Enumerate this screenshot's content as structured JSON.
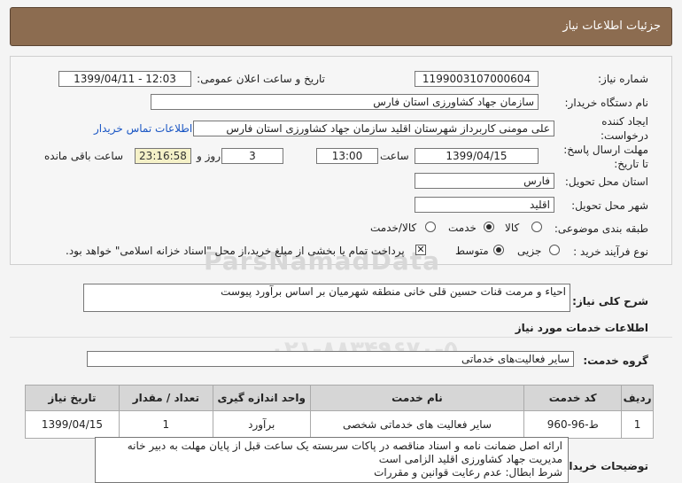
{
  "header": {
    "title": "جزئیات اطلاعات نیاز"
  },
  "fields": {
    "need_number_label": "شماره نیاز:",
    "need_number": "1199003107000604",
    "announce_label": "تاریخ و ساعت اعلان عمومی:",
    "announce_value": "1399/04/11 - 12:03",
    "buyer_label": "نام دستگاه خریدار:",
    "buyer_value": "سازمان جهاد کشاورزی استان فارس",
    "creator_label_1": "ایجاد کننده",
    "creator_label_2": "درخواست:",
    "creator_value": "علی  مومنی  کاربرداز شهرستان اقلید  سازمان جهاد کشاورزی استان فارس",
    "contact_link": "اطلاعات تماس خریدار",
    "deadline_label_1": "مهلت ارسال پاسخ:",
    "deadline_label_2": "تا تاریخ:",
    "deadline_date": "1399/04/15",
    "time_label": "ساعت",
    "deadline_time": "13:00",
    "days_value": "3",
    "days_label": "روز و",
    "remaining_time": "23:16:58",
    "remaining_label": "ساعت باقی مانده",
    "province_label": "استان محل تحویل:",
    "province_value": "فارس",
    "city_label": "شهر محل تحویل:",
    "city_value": "اقلید",
    "category_label": "طبقه بندی موضوعی:",
    "category_options": [
      "کالا",
      "خدمت",
      "کالا/خدمت"
    ],
    "category_selected": "خدمت",
    "process_label": "نوع فرآیند خرید :",
    "process_options": [
      "جزیی",
      "متوسط"
    ],
    "process_selected": "متوسط",
    "payment_note": "پرداخت تمام یا بخشی از مبلغ خرید،از محل \"اسناد خزانه اسلامی\" خواهد بود."
  },
  "summary": {
    "label": "شرح کلی نیاز:",
    "value": "احیاء و مرمت قنات حسین قلی خانی منطقه شهرمیان بر اساس برآورد پیوست"
  },
  "services_section": {
    "title": "اطلاعات خدمات مورد نیاز",
    "group_label": "گروه خدمت:",
    "group_value": "سایر فعالیت‌های خدماتی"
  },
  "table": {
    "headers": [
      "ردیف",
      "کد خدمت",
      "نام خدمت",
      "واحد اندازه گیری",
      "تعداد / مقدار",
      "تاریخ نیاز"
    ],
    "rows": [
      [
        "1",
        "ط-96-960",
        "سایر فعالیت های خدماتی شخصی",
        "برآورد",
        "1",
        "1399/04/15"
      ]
    ]
  },
  "notes": {
    "label": "توضیحات خریدار:",
    "lines": [
      "ارائه اصل ضمانت نامه و اسناد مناقصه  در پاکات سربسته یک ساعت قبل از پایان مهلت به دبیر خانه",
      "مدیریت جهاد کشاورزی اقلید الزامی است",
      "شرط ابطال: عدم رعایت قوانین و مقررات"
    ]
  },
  "watermark": {
    "line1": "ParsNamadData",
    "line2": "۰۲۱-۸۸۳۴۹۶۷۰-۵"
  }
}
